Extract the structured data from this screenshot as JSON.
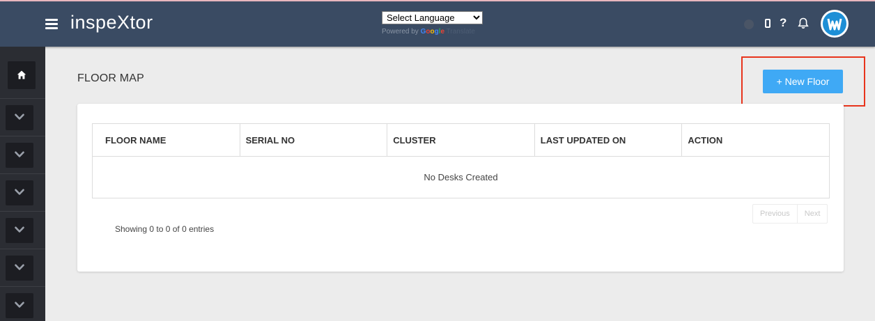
{
  "app": {
    "title": "inspeXtor"
  },
  "language": {
    "selected": "Select Language",
    "powered_by": "Powered by",
    "google": [
      "G",
      "o",
      "o",
      "g",
      "l",
      "e"
    ],
    "translate": "Translate"
  },
  "header_icons": [
    "status-dot",
    "phone-icon",
    "help-icon",
    "bell-icon",
    "avatar"
  ],
  "help_glyph": "?",
  "page": {
    "title": "FLOOR MAP"
  },
  "actions": {
    "new_floor": "+ New Floor"
  },
  "table": {
    "columns": [
      "FLOOR NAME",
      "SERIAL NO",
      "CLUSTER",
      "LAST UPDATED ON",
      "ACTION"
    ],
    "empty_message": "No Desks Created"
  },
  "pagination": {
    "info": "Showing 0 to 0 of 0 entries",
    "previous": "Previous",
    "next": "Next"
  },
  "sidebar": {
    "home_icon": "home-icon",
    "items": [
      "chevron-down-icon",
      "chevron-down-icon",
      "chevron-down-icon",
      "chevron-down-icon",
      "chevron-down-icon",
      "chevron-down-icon"
    ]
  },
  "colors": {
    "header": "#3a4b63",
    "sidebar": "#2b2d33",
    "accent": "#3fa9f5",
    "highlight": "#e8341c"
  }
}
